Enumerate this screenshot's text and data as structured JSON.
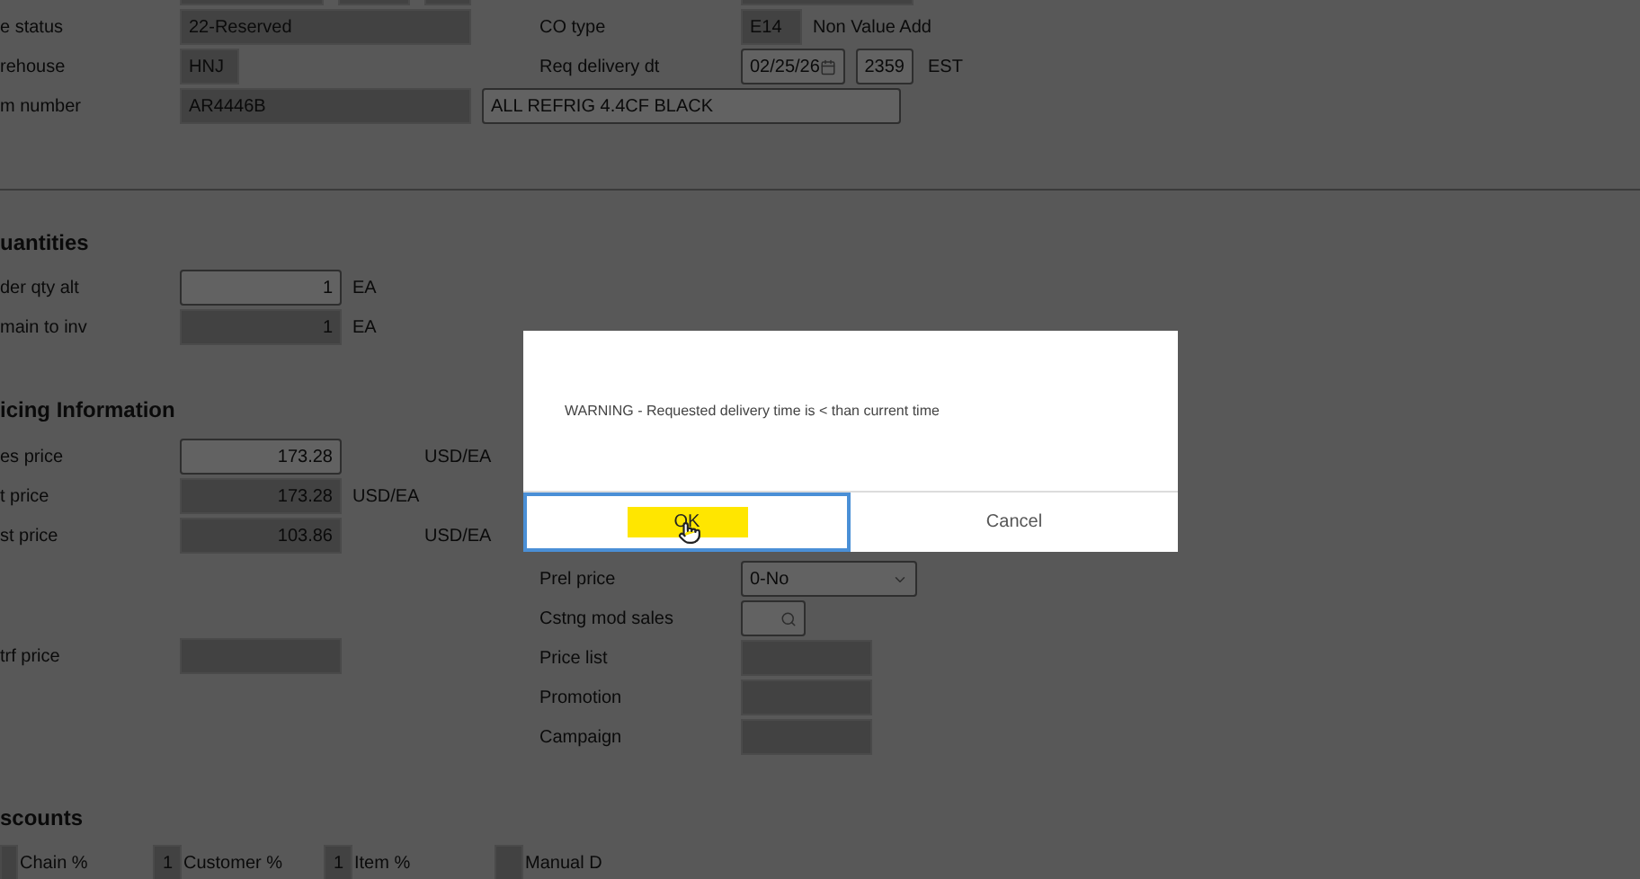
{
  "general": {
    "fields": [
      {
        "label": "e status",
        "value": "22-Reserved"
      },
      {
        "label": "rehouse",
        "value": "HNJ"
      },
      {
        "label": "m number",
        "value": "AR4446B",
        "description": "ALL REFRIG 4.4CF BLACK"
      }
    ],
    "co_type": {
      "label": "CO type",
      "value": "E14",
      "note": "Non Value Add"
    },
    "req_delivery": {
      "label": "Req delivery dt",
      "date": "02/25/26",
      "time": "2359",
      "zone": "EST"
    }
  },
  "quantities": {
    "title": "uantities",
    "fields": [
      {
        "label": "der qty alt",
        "value": "1",
        "unit": "EA",
        "editable": true
      },
      {
        "label": "main to inv",
        "value": "1",
        "unit": "EA",
        "editable": false
      }
    ]
  },
  "pricing": {
    "title": "icing Information",
    "fields": [
      {
        "label": "es price",
        "value": "173.28",
        "unit": "USD/EA",
        "editable": true
      },
      {
        "label": "t price",
        "value": "173.28",
        "unit": "USD/EA",
        "editable": false
      },
      {
        "label": "st price",
        "value": "103.86",
        "unit": "USD/EA",
        "editable": false
      }
    ],
    "trf": {
      "label": "trf price",
      "editable": false
    },
    "right_fields": [
      {
        "label": "Prel price",
        "kind": "select",
        "value": "0-No"
      },
      {
        "label": "Cstng mod sales",
        "kind": "lookup"
      },
      {
        "label": "Price list",
        "kind": "text"
      },
      {
        "label": "Promotion",
        "kind": "text"
      },
      {
        "label": "Campaign",
        "kind": "text"
      }
    ]
  },
  "discounts": {
    "title": "scounts",
    "fields": [
      {
        "label": "Chain %"
      },
      {
        "label": "Customer %",
        "value": "1"
      },
      {
        "label": "Item %",
        "value": "1"
      },
      {
        "label": "Manual D"
      }
    ]
  },
  "dialog": {
    "message": "WARNING - Requested delivery time is < than current time",
    "buttons": [
      {
        "label": "OK",
        "selected": true,
        "highlighted": true
      },
      {
        "label": "Cancel",
        "selected": false,
        "highlighted": false
      }
    ]
  }
}
